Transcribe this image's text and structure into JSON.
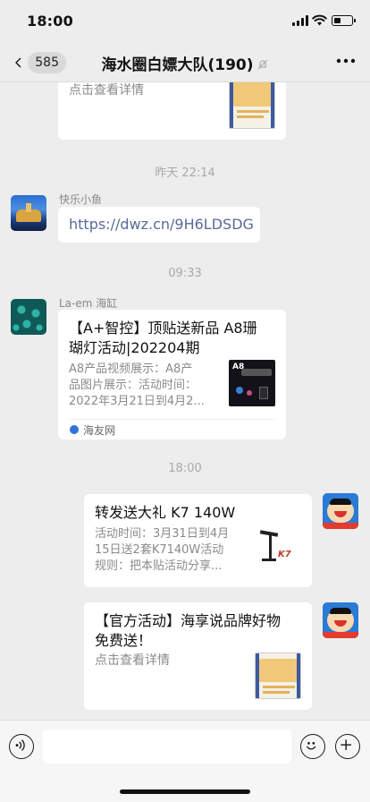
{
  "status_bar": {
    "time": "18:00"
  },
  "nav": {
    "back_count": "585",
    "title": "海水圈白嫖大队(190)"
  },
  "messages": {
    "top_card": {
      "desc": "点击查看详情"
    },
    "timestamp_1": "昨天 22:14",
    "msg_1": {
      "sender": "快乐小鱼",
      "text": "https://dwz.cn/9H6LDSDG"
    },
    "timestamp_2": "09:33",
    "msg_2": {
      "sender": "La-em 海缸",
      "title_line1": "【A+智控】顶贴送新品 A8珊",
      "title_line2": "瑚灯活动|202204期",
      "desc_line1": "A8产品视频展示：A8产",
      "desc_line2": "品图片展示：活动时间：",
      "desc_line3": "2022年3月21日到4月2...",
      "source": "海友网",
      "thumb_label": "A8"
    },
    "timestamp_3": "18:00",
    "msg_3": {
      "title": "转发送大礼 K7 140W",
      "desc_line1": "活动时间：3月31日到4月",
      "desc_line2": "15日送2套K7140W活动",
      "desc_line3": "规则：把本贴活动分享...",
      "thumb_label": "K7"
    },
    "msg_4": {
      "title_line1": "【官方活动】海享说品牌好物",
      "title_line2": "免费送！",
      "desc": "点击查看详情"
    }
  },
  "input_bar": {
    "placeholder": ""
  },
  "colors": {
    "background": "#ededed",
    "bubble": "#ffffff",
    "link": "#576b95",
    "muted": "#a9a9a9"
  }
}
